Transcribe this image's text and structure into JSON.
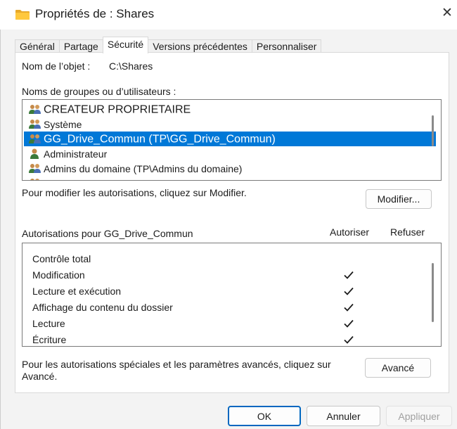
{
  "window": {
    "title": "Propriétés de : Shares",
    "close_glyph": "✕",
    "folder_icon": "folder-icon",
    "accent_color": "#0078d7"
  },
  "tabs": [
    {
      "label": "Général",
      "active": false
    },
    {
      "label": "Partage",
      "active": false
    },
    {
      "label": "Sécurité",
      "active": true
    },
    {
      "label": "Versions précédentes",
      "active": false
    },
    {
      "label": "Personnaliser",
      "active": false
    }
  ],
  "object": {
    "label": "Nom de l’objet :",
    "value": "C:\\Shares"
  },
  "groups": {
    "label": "Noms de groupes ou d’utilisateurs :",
    "items": [
      {
        "name": "CREATEUR PROPRIETAIRE",
        "icon": "group-icon",
        "selected": false
      },
      {
        "name": "Système",
        "icon": "group-icon",
        "selected": false
      },
      {
        "name": "GG_Drive_Commun (TP\\GG_Drive_Commun)",
        "icon": "group-icon",
        "selected": true
      },
      {
        "name": "Administrateur",
        "icon": "user-icon",
        "selected": false
      },
      {
        "name": "Admins du domaine (TP\\Admins du domaine)",
        "icon": "group-icon",
        "selected": false
      }
    ]
  },
  "modify": {
    "hint": "Pour modifier les autorisations, cliquez sur Modifier.",
    "button": "Modifier..."
  },
  "permissions": {
    "label": "Autorisations pour GG_Drive_Commun",
    "allow_header": "Autoriser",
    "deny_header": "Refuser",
    "check_glyph": "checkmark-icon",
    "items": [
      {
        "name": "Contrôle total",
        "allow": false,
        "deny": false
      },
      {
        "name": "Modification",
        "allow": true,
        "deny": false
      },
      {
        "name": "Lecture et exécution",
        "allow": true,
        "deny": false
      },
      {
        "name": "Affichage du contenu du dossier",
        "allow": true,
        "deny": false
      },
      {
        "name": "Lecture",
        "allow": true,
        "deny": false
      },
      {
        "name": "Écriture",
        "allow": true,
        "deny": false
      }
    ]
  },
  "advanced": {
    "hint_line1": "Pour les autorisations spéciales et les paramètres avancés, cliquez sur",
    "hint_line2": "Avancé.",
    "button": "Avancé"
  },
  "footer": {
    "ok": "OK",
    "cancel": "Annuler",
    "apply": "Appliquer"
  }
}
